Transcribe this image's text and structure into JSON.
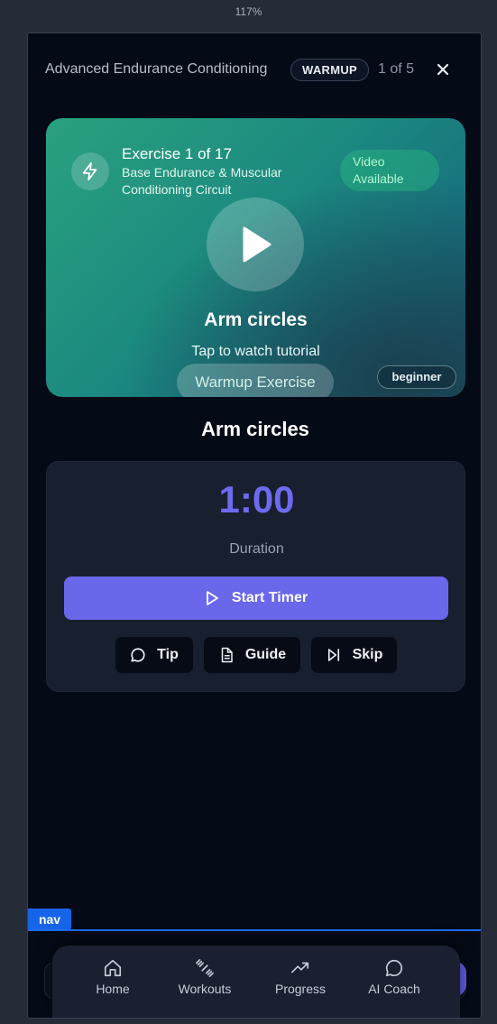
{
  "browser": {
    "zoom": "117%"
  },
  "header": {
    "title": "Advanced Endurance Conditioning",
    "phase_badge": "WARMUP",
    "counter": "1 of 5",
    "close_icon": "close-icon"
  },
  "hero": {
    "icon": "lightning-bolt-icon",
    "exercise_count": "Exercise 1 of 17",
    "circuit_name": "Base Endurance & Muscular Conditioning Circuit",
    "video_badge": "Video Available",
    "play_icon": "play-icon",
    "title": "Arm circles",
    "tap_hint": "Tap to watch tutorial",
    "type_pill": "Warmup Exercise",
    "level": "beginner"
  },
  "exercise": {
    "name": "Arm circles"
  },
  "timer": {
    "value": "1:00",
    "label": "Duration",
    "start_label": "Start Timer",
    "start_icon": "play-outline-icon"
  },
  "actions": [
    {
      "label": "Tip",
      "icon": "chat-bubble-icon"
    },
    {
      "label": "Guide",
      "icon": "document-icon"
    },
    {
      "label": "Skip",
      "icon": "skip-forward-icon"
    }
  ],
  "devtools": {
    "nav_tag": "nav"
  },
  "bottom_nav": {
    "items": [
      {
        "label": "Home",
        "icon": "home-icon"
      },
      {
        "label": "Workouts",
        "icon": "dumbbell-icon"
      },
      {
        "label": "Progress",
        "icon": "trending-up-icon"
      },
      {
        "label": "AI Coach",
        "icon": "chat-bubble-icon"
      }
    ]
  },
  "colors": {
    "background": "#050a17",
    "accent": "#6a67ea",
    "hero_teal": "#1c8a80",
    "video_badge_green": "#b4f5cf",
    "nav_tag_blue": "#1665e8"
  }
}
